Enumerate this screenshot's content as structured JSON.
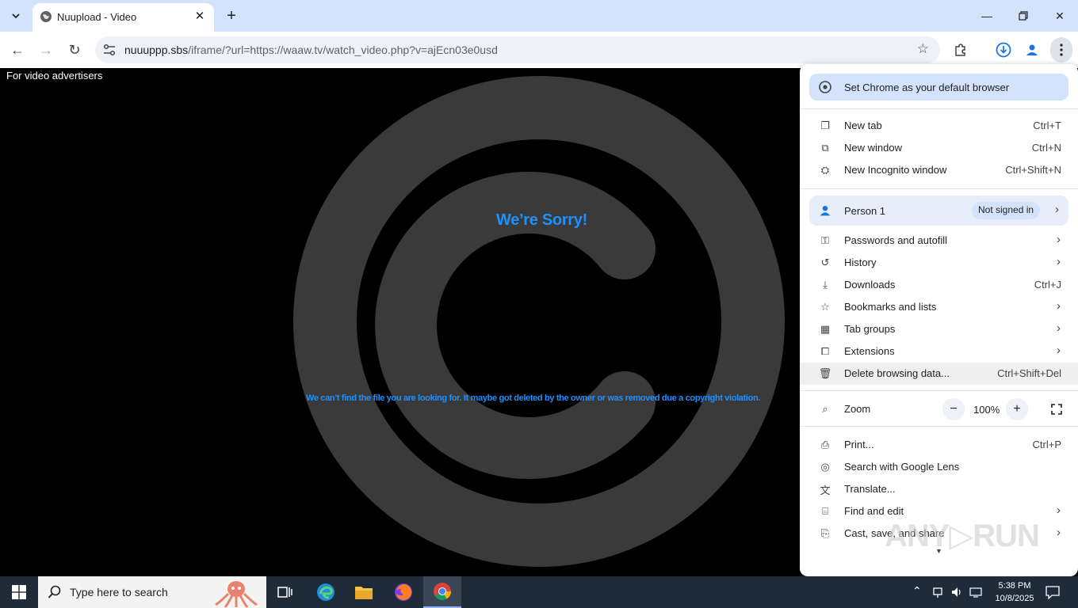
{
  "browser": {
    "tab_title": "Nuupload - Video",
    "url_host": "nuuuppp.sbs",
    "url_path": "/iframe/?url=https://waaw.tv/watch_video.php?v=ajEcn03e0usd"
  },
  "page": {
    "advertisers_text": "For video advertisers",
    "sorry_title": "We’re Sorry!",
    "sorry_message": "We can’t find the file you are looking for. It maybe got deleted by the owner or was removed due a copyright violation."
  },
  "menu": {
    "default_browser": "Set Chrome as your default browser",
    "items_group1": [
      {
        "label": "New tab",
        "shortcut": "Ctrl+T",
        "icon": "new-tab-icon"
      },
      {
        "label": "New window",
        "shortcut": "Ctrl+N",
        "icon": "new-window-icon"
      },
      {
        "label": "New Incognito window",
        "shortcut": "Ctrl+Shift+N",
        "icon": "incognito-icon"
      }
    ],
    "person_name": "Person 1",
    "person_status": "Not signed in",
    "items_group2": [
      {
        "label": "Passwords and autofill",
        "icon": "key-icon"
      },
      {
        "label": "History",
        "icon": "history-icon"
      },
      {
        "label": "Downloads",
        "shortcut": "Ctrl+J",
        "icon": "download-icon"
      },
      {
        "label": "Bookmarks and lists",
        "icon": "star-icon"
      },
      {
        "label": "Tab groups",
        "icon": "tab-groups-icon"
      },
      {
        "label": "Extensions",
        "icon": "puzzle-icon"
      },
      {
        "label": "Delete browsing data...",
        "shortcut": "Ctrl+Shift+Del",
        "icon": "trash-icon"
      }
    ],
    "zoom_label": "Zoom",
    "zoom_value": "100%",
    "items_group3": [
      {
        "label": "Print...",
        "shortcut": "Ctrl+P",
        "icon": "print-icon"
      },
      {
        "label": "Search with Google Lens",
        "icon": "lens-icon"
      },
      {
        "label": "Translate...",
        "icon": "translate-icon"
      },
      {
        "label": "Find and edit",
        "icon": "find-icon"
      },
      {
        "label": "Cast, save, and share",
        "icon": "cast-icon"
      }
    ]
  },
  "taskbar": {
    "search_placeholder": "Type here to search",
    "time": "5:38 PM",
    "date": "10/8/2025"
  },
  "watermark": "ANY RUN"
}
